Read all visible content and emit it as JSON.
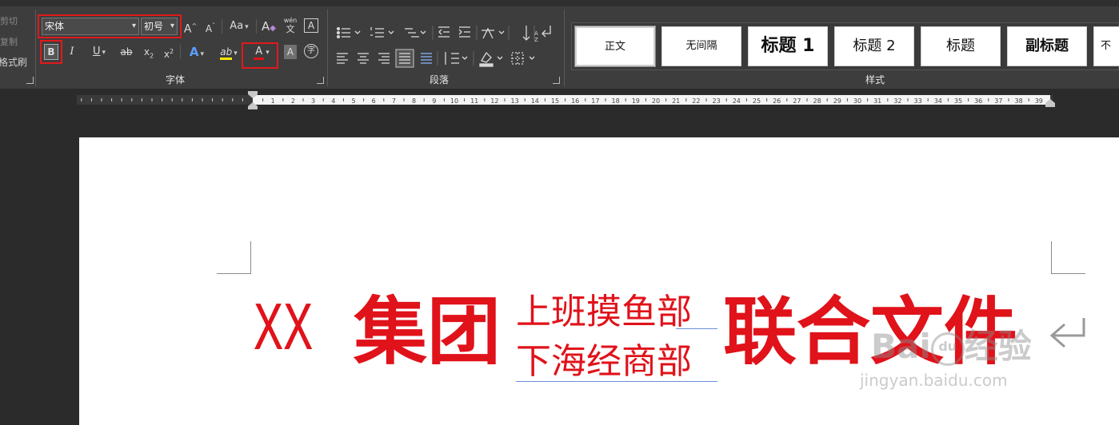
{
  "clipboard": {
    "cut": "剪切",
    "copy": "复制",
    "format_painter": "格式刷"
  },
  "font_group": {
    "label": "字体",
    "font_name": "宋体",
    "font_size": "初号",
    "grow_font": "A",
    "shrink_font": "A",
    "change_case": "Aa",
    "clear_format": "A",
    "phonetic_top": "wén",
    "phonetic_bottom": "文",
    "char_border": "A",
    "bold": "B",
    "italic": "I",
    "underline": "U",
    "strikethrough": "ab",
    "subscript": "x",
    "superscript": "x",
    "text_effects": "A",
    "highlight": "ab",
    "font_color": "A",
    "char_shading": "A",
    "enclose": "字"
  },
  "paragraph_group": {
    "label": "段落"
  },
  "styles_group": {
    "label": "样式",
    "items": [
      "正文",
      "无间隔",
      "标题 1",
      "标题 2",
      "标题",
      "副标题",
      "不"
    ]
  },
  "ruler": {
    "numbers": [
      1,
      2,
      3,
      4,
      5,
      6,
      7,
      8,
      9,
      10,
      11,
      12,
      13,
      14,
      15,
      16,
      17,
      18,
      19,
      20,
      21,
      22,
      23,
      24,
      25,
      26,
      27,
      28,
      29,
      30,
      31,
      32,
      33,
      34,
      35,
      36,
      37,
      38,
      39
    ]
  },
  "document": {
    "prefix": "XX",
    "group": "集团",
    "dept_top": "上班摸鱼部",
    "dept_bottom": "下海经商部",
    "suffix": "联合文件"
  },
  "watermark": {
    "brand": "Bai",
    "paw": "du",
    "exp": "经验",
    "url": "jingyan.baidu.com"
  },
  "colors": {
    "accent_red": "#e0121a",
    "highlight_red": "#e0191b"
  }
}
